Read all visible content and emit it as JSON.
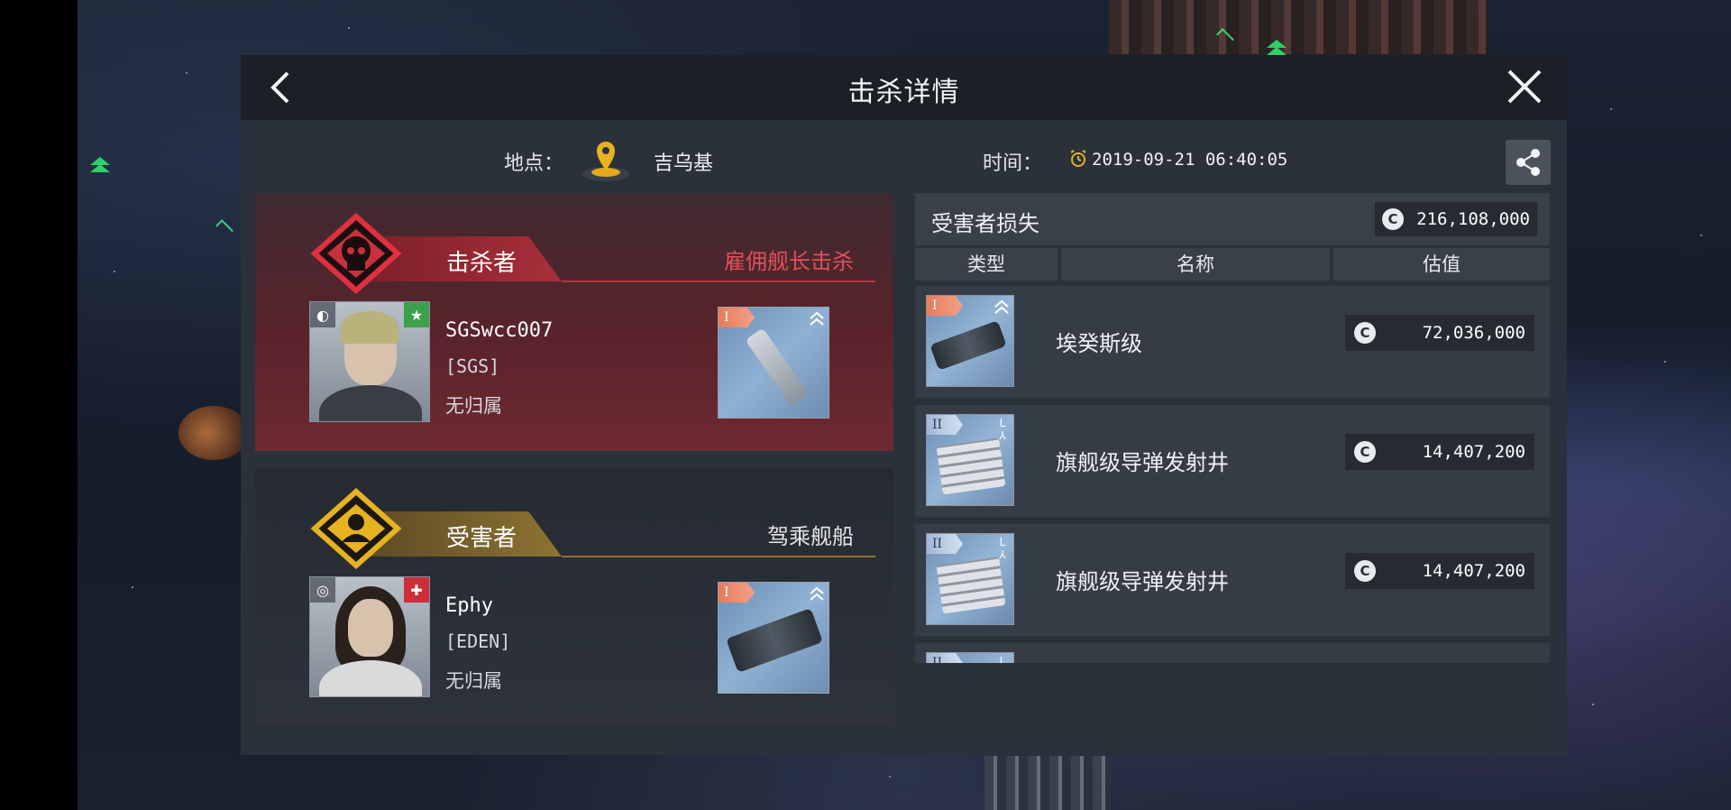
{
  "header": {
    "title": "击杀详情"
  },
  "info": {
    "location_label": "地点：",
    "location_value": "吉乌基",
    "time_label": "时间：",
    "time_value": "2019-09-21 06:40:05"
  },
  "killer": {
    "role_label": "击杀者",
    "role_note": "雇佣舰长击杀",
    "name": "SGSwcc007",
    "corp": "[SGS]",
    "alliance": "无归属",
    "ship_tier": "I"
  },
  "victim": {
    "role_label": "受害者",
    "role_note": "驾乘舰船",
    "name": "Ephy",
    "corp": "[EDEN]",
    "alliance": "无归属",
    "ship_tier": "I"
  },
  "losses": {
    "title": "受害者损失",
    "total": "216,108,000",
    "currency_symbol": "C",
    "columns": [
      "类型",
      "名称",
      "估值"
    ],
    "items": [
      {
        "tier": "I",
        "name": "埃癸斯级",
        "value": "72,036,000",
        "kind": "ship"
      },
      {
        "tier": "II",
        "name": "旗舰级导弹发射井",
        "value": "14,407,200",
        "kind": "launcher"
      },
      {
        "tier": "II",
        "name": "旗舰级导弹发射井",
        "value": "14,407,200",
        "kind": "launcher"
      },
      {
        "tier": "II",
        "name": "",
        "value": "",
        "kind": "launcher"
      }
    ]
  },
  "colors": {
    "killer_accent": "#c0303c",
    "victim_accent": "#e7b221",
    "panel_bg": "#2b313b"
  }
}
